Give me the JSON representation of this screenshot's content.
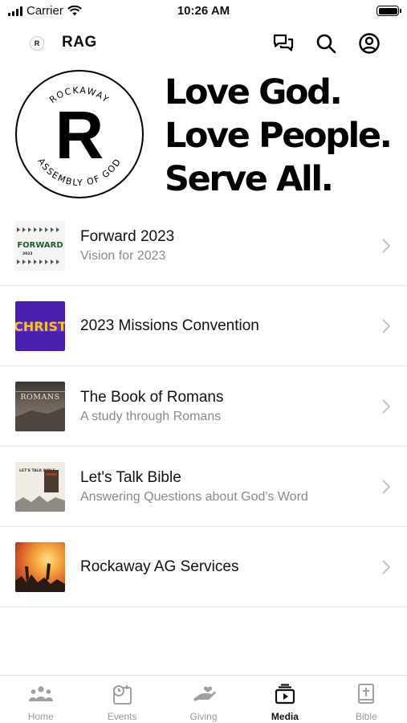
{
  "status_bar": {
    "carrier": "Carrier",
    "time": "10:26 AM"
  },
  "header": {
    "logo_letter": "R",
    "title": "RAG",
    "icons": [
      "chat-bubbles-icon",
      "search-icon",
      "profile-icon"
    ]
  },
  "hero": {
    "seal": {
      "letter": "R",
      "top_text": "ROCKAWAY",
      "bottom_text": "ASSEMBLY OF GOD"
    },
    "slogan": [
      "Love God.",
      "Love People.",
      "Serve All."
    ]
  },
  "media_items": [
    {
      "title": "Forward 2023",
      "subtitle": "Vision for 2023",
      "thumb_text": "FORWARD",
      "thumb_small": "2023"
    },
    {
      "title": "2023 Missions Convention",
      "subtitle": "",
      "thumb_text": "CHRIST"
    },
    {
      "title": "The Book of Romans",
      "subtitle": "A study through Romans",
      "thumb_text": "ROMANS"
    },
    {
      "title": "Let's Talk Bible",
      "subtitle": "Answering Questions about God's Word",
      "thumb_text": "LET'S TALK BIBLE"
    },
    {
      "title": "Rockaway AG Services",
      "subtitle": ""
    }
  ],
  "tabs": [
    {
      "label": "Home",
      "icon": "people-icon",
      "active": false
    },
    {
      "label": "Events",
      "icon": "calendar-clock-icon",
      "active": false
    },
    {
      "label": "Giving",
      "icon": "giving-hand-icon",
      "active": false
    },
    {
      "label": "Media",
      "icon": "media-play-icon",
      "active": true
    },
    {
      "label": "Bible",
      "icon": "bible-icon",
      "active": false
    }
  ],
  "colors": {
    "accent": "#111111",
    "inactive_tab": "#9a9a9a",
    "subtitle": "#8a8a8a",
    "missions_thumb": "#4a1fb0",
    "missions_text": "#f5c518"
  }
}
